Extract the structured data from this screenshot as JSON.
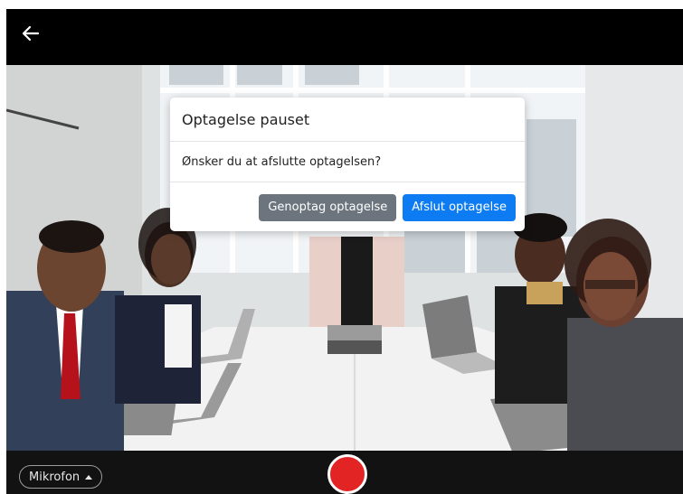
{
  "header": {
    "back_icon": "arrow-left-icon"
  },
  "dialog": {
    "title": "Optagelse pauset",
    "message": "Ønsker du at afslutte optagelsen?",
    "resume_label": "Genoptag optagelse",
    "finish_label": "Afslut optagelse"
  },
  "controls": {
    "mic_label": "Mikrofon",
    "mic_caret_icon": "caret-up-icon",
    "record_icon": "record-icon"
  },
  "colors": {
    "primary": "#0d7cf2",
    "secondary": "#6c757d",
    "record": "#e32424"
  }
}
